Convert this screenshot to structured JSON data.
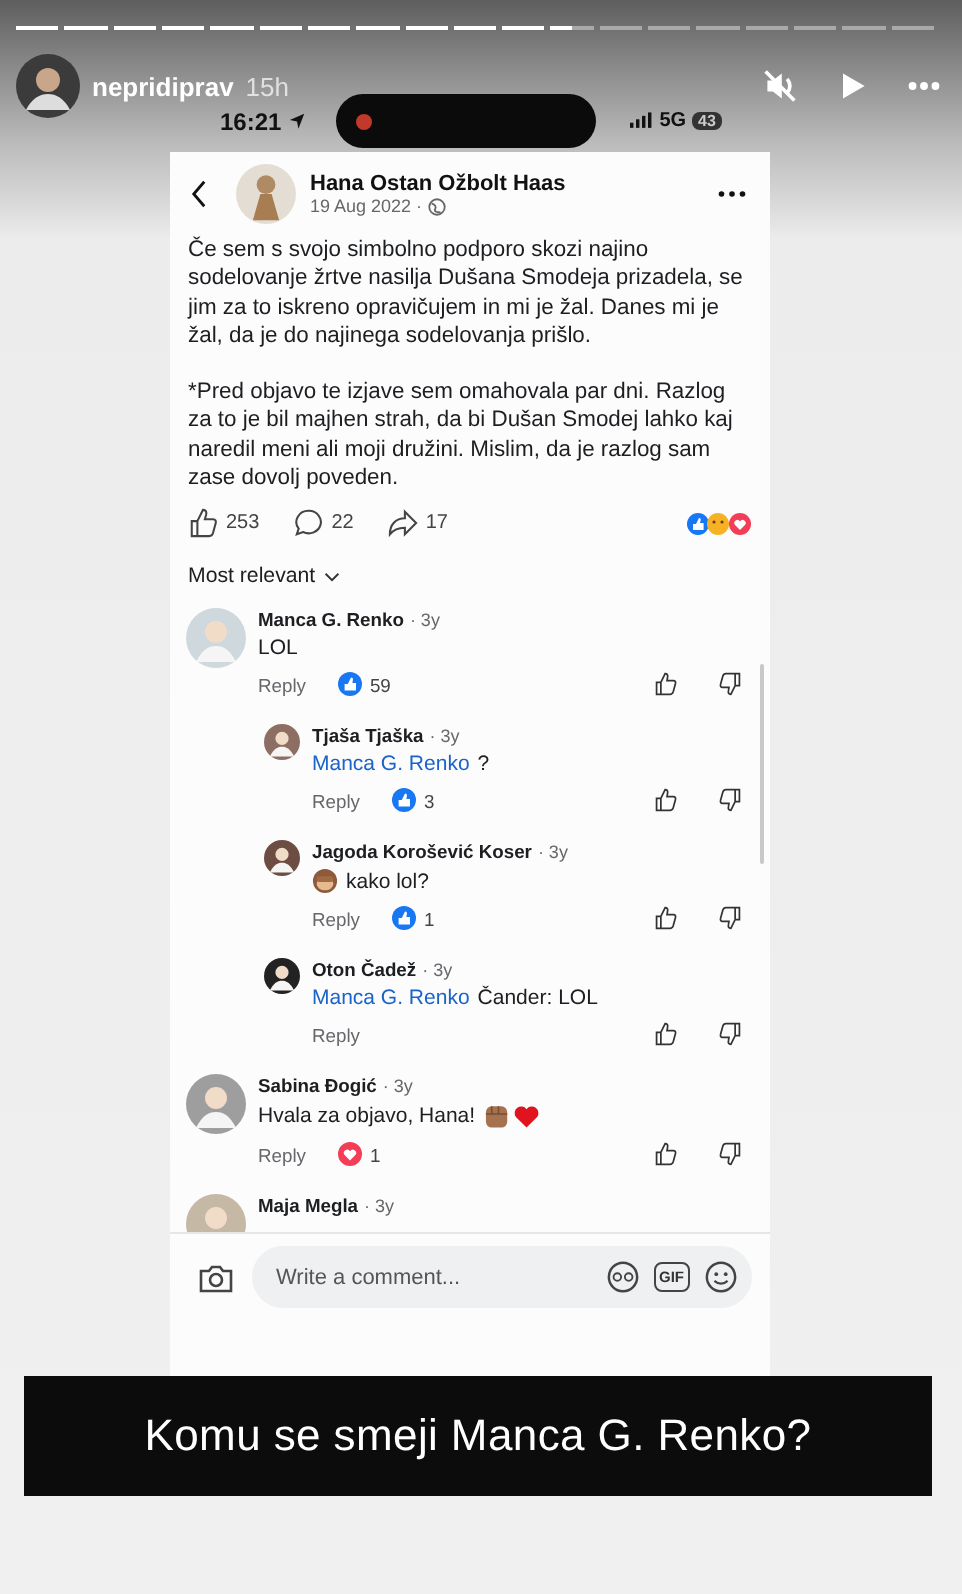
{
  "story": {
    "segments": [
      {
        "level": 1
      },
      {
        "level": 1
      },
      {
        "level": 1
      },
      {
        "level": 1
      },
      {
        "level": 1
      },
      {
        "level": 1
      },
      {
        "level": 1
      },
      {
        "level": 1
      },
      {
        "level": 1
      },
      {
        "level": 1
      },
      {
        "level": 1
      },
      {
        "level": 0.5
      },
      {
        "level": 0
      },
      {
        "level": 0
      },
      {
        "level": 0
      },
      {
        "level": 0
      },
      {
        "level": 0
      },
      {
        "level": 0
      },
      {
        "level": 0
      }
    ],
    "user": "nepridiprav",
    "age": "15h",
    "muted": true
  },
  "phone_status": {
    "time": "16:21",
    "network": "5G",
    "battery": "43"
  },
  "post": {
    "author": "Hana Ostan Ožbolt Haas",
    "date": "19 Aug 2022 ·",
    "paragraphs": [
      "Če sem s svojo simbolno podporo skozi najino sodelovanje žrtve nasilja Dušana Smodeja prizadela, se jim za to iskreno opravičujem in mi je žal. Danes mi je žal, da je do najinega sodelovanja prišlo.",
      "*Pred objavo te izjave sem omahovala par dni. Razlog za to je bil majhen strah, da bi Dušan Smodej lahko kaj naredil meni ali moji družini. Mislim, da je razlog sam zase dovolj poveden."
    ],
    "likes": "253",
    "comments": "22",
    "shares": "17"
  },
  "sort": "Most relevant",
  "comments": [
    {
      "name": "Manca G. Renko",
      "time": "· 3y",
      "text": "LOL",
      "reply": "Reply",
      "reaction": {
        "kind": "like",
        "count": "59"
      },
      "children": [
        {
          "name": "Tjaša Tjaška",
          "time": "· 3y",
          "mention": "Manca G. Renko",
          "text": "?",
          "reply": "Reply",
          "reaction": {
            "kind": "like",
            "count": "3"
          }
        },
        {
          "name": "Jagoda Korošević Koser",
          "time": "· 3y",
          "text": "kako lol?",
          "leading_emoji": true,
          "reply": "Reply",
          "reaction": {
            "kind": "like",
            "count": "1"
          }
        },
        {
          "name": "Oton Čadež",
          "time": "· 3y",
          "mention": "Manca G. Renko",
          "text": "Čander: LOL",
          "reply": "Reply"
        }
      ]
    },
    {
      "name": "Sabina Đogić",
      "time": "· 3y",
      "text": "Hvala za objavo, Hana!",
      "trailing_emoji": true,
      "reply": "Reply",
      "reaction": {
        "kind": "love",
        "count": "1"
      }
    },
    {
      "name": "Maja Megla",
      "time": "· 3y"
    }
  ],
  "composer": {
    "placeholder": "Write a comment...",
    "gif": "GIF"
  },
  "caption": "Komu se smeji Manca G. Renko?"
}
